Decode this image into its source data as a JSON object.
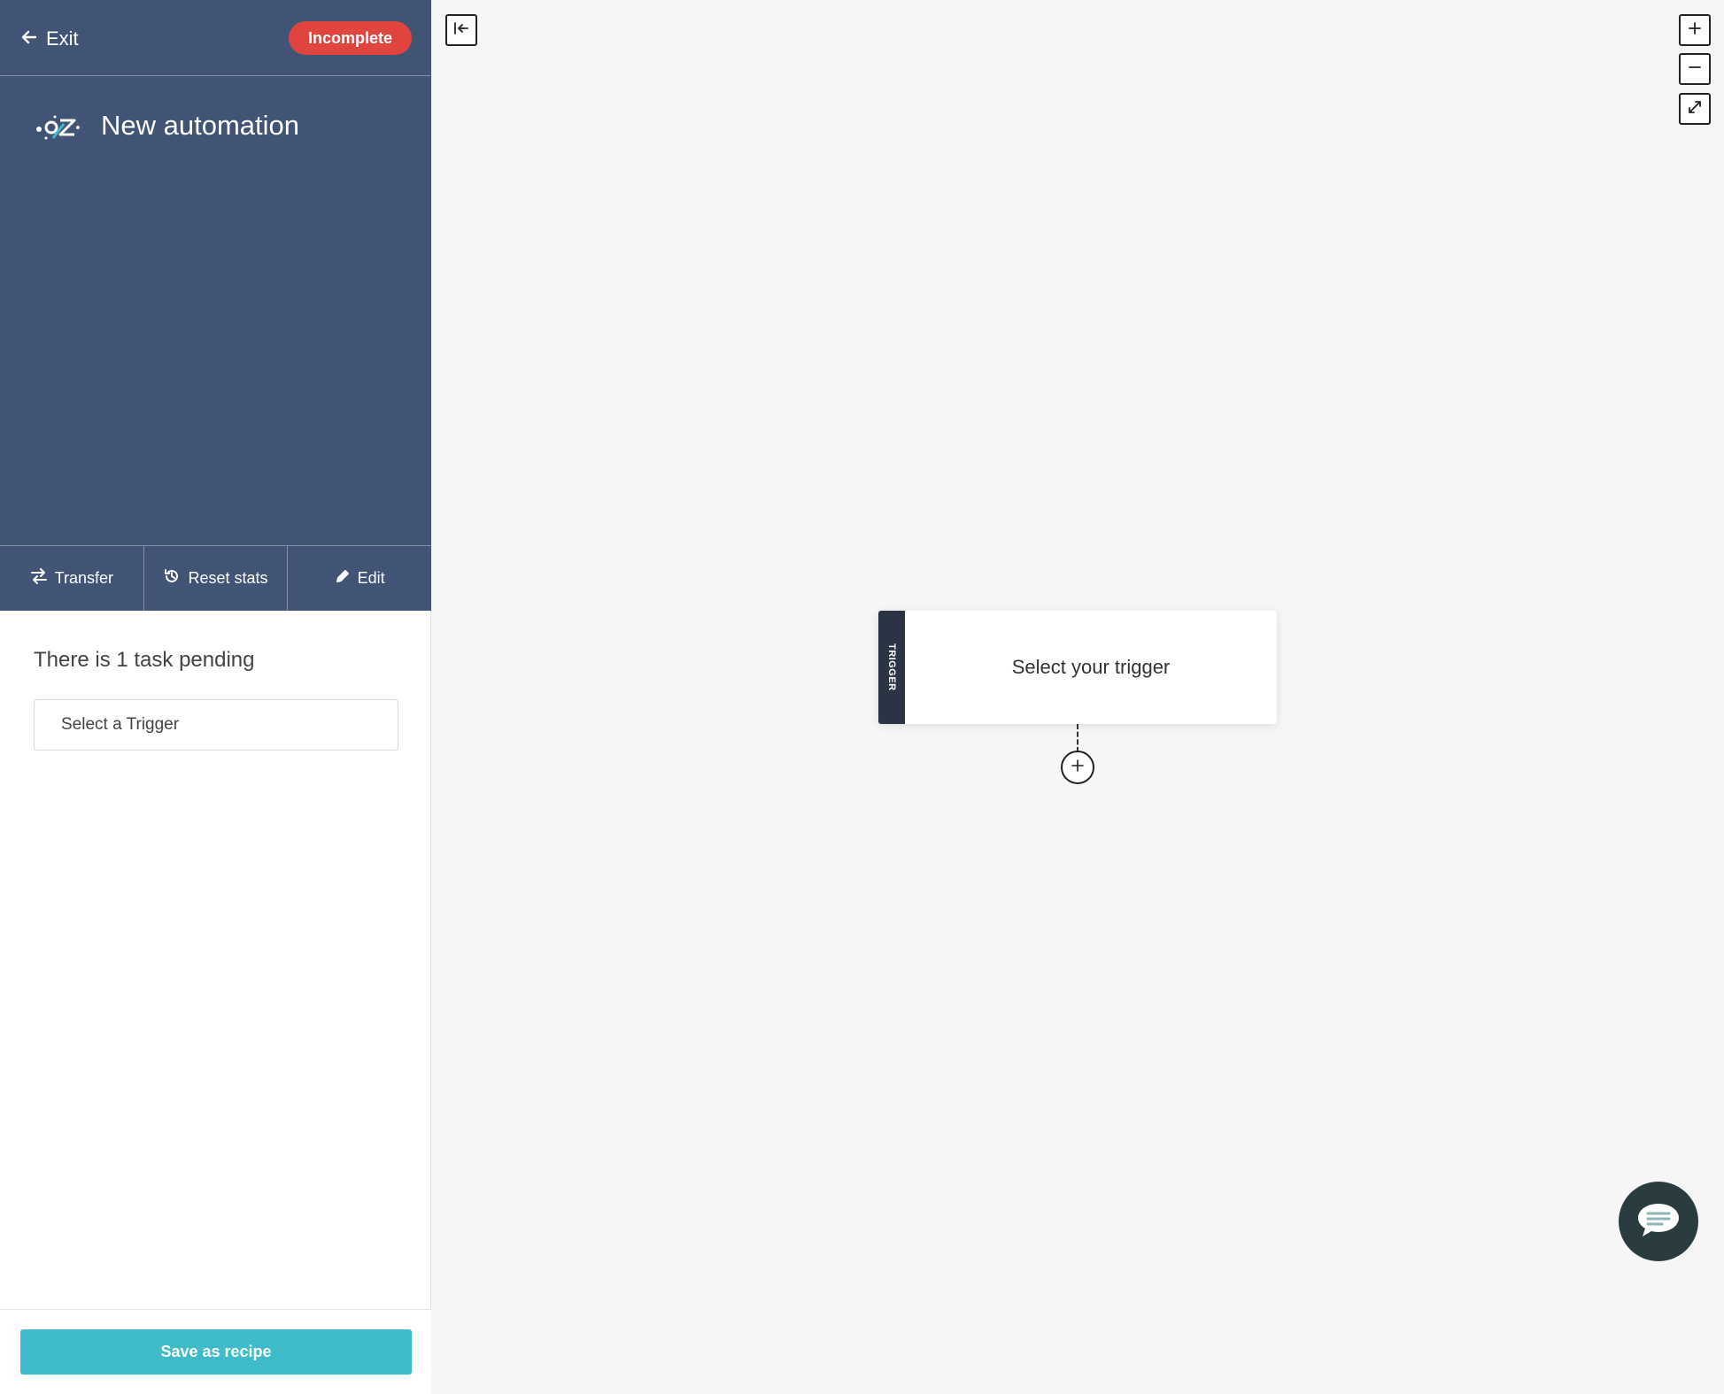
{
  "header": {
    "exit_label": "Exit",
    "status": "Incomplete"
  },
  "automation": {
    "title": "New automation"
  },
  "toolbar": {
    "transfer_label": "Transfer",
    "reset_label": "Reset stats",
    "edit_label": "Edit"
  },
  "tasks": {
    "pending_text": "There is 1 task pending",
    "items": [
      {
        "label": "Select a Trigger"
      }
    ]
  },
  "footer": {
    "save_label": "Save as recipe"
  },
  "canvas": {
    "trigger_tab": "TRIGGER",
    "trigger_placeholder": "Select your trigger"
  },
  "icons": {
    "exit": "arrow-left-icon",
    "transfer": "transfer-icon",
    "reset": "history-icon",
    "edit": "pencil-icon",
    "collapse": "collapse-left-icon",
    "zoom_in": "plus-icon",
    "zoom_out": "minus-icon",
    "fit": "expand-icon",
    "add_step": "plus-circle-icon",
    "chat": "chat-bubble-icon"
  },
  "colors": {
    "sidebar_header": "#425476",
    "status_badge": "#e0443f",
    "primary_button": "#3fbac8",
    "trigger_tab": "#2b3445",
    "chat_button": "#2a3c3f",
    "canvas_bg": "#f6f6f6"
  }
}
